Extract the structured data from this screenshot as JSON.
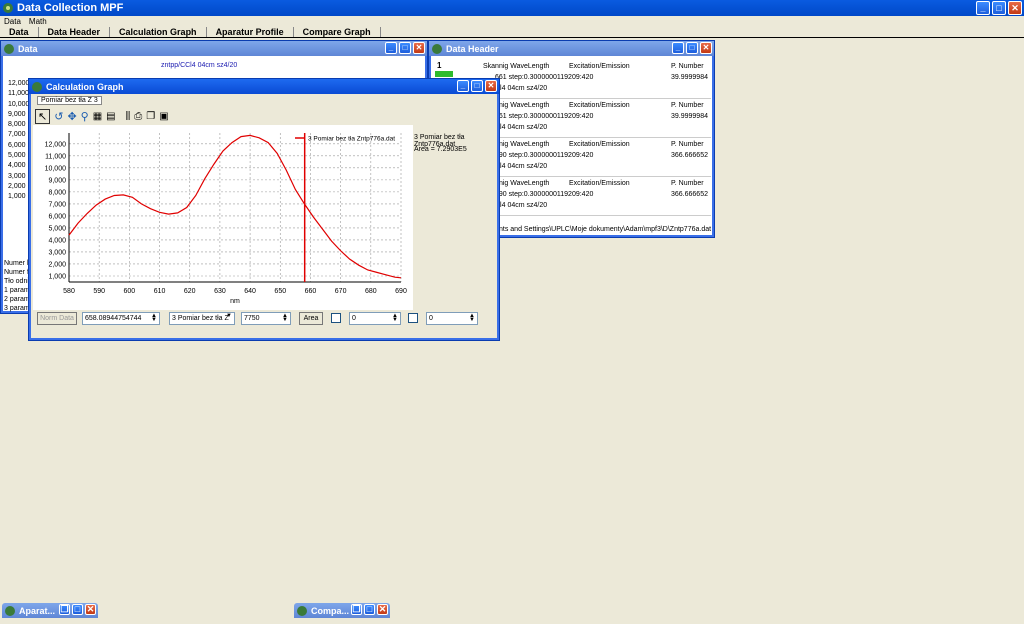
{
  "app": {
    "title": "Data Collection MPF"
  },
  "menu": [
    "Data",
    "Math"
  ],
  "tabs": [
    "Data",
    "Data Header",
    "Calculation Graph",
    "Aparatur Profile",
    "Compare Graph"
  ],
  "data_window": {
    "title": "Data",
    "subtitle": "zntpp/CCl4 04cm sz4/20",
    "y_values": [
      "12,000",
      "11,000",
      "10,000",
      "9,000",
      "8,000",
      "7,000",
      "6,000",
      "5,000",
      "4,000",
      "3,000",
      "2,000",
      "1,000"
    ],
    "info_lines": [
      "Numer k",
      "Numer fil",
      "Tło odni",
      "1 param",
      "2 param",
      "3 param"
    ]
  },
  "header_window": {
    "title": "Data Header",
    "index": "1",
    "entries": [
      {
        "col1": "Skannig WaveLength",
        "col2": "Excitation/Emission",
        "col3": "P. Number",
        "line2": "661 step:0.3000000119209:420",
        "val": "39.9999984",
        "line3": "Cl4 04cm sz4/20"
      },
      {
        "col1": "Skannig WaveLength",
        "col2": "Excitation/Emission",
        "col3": "P. Number",
        "line2": "661 step:0.3000000119209:420",
        "val": "39.9999984",
        "line3": "Cl4 04cm sz4/20"
      },
      {
        "col1": "Skannig WaveLength",
        "col2": "Excitation/Emission",
        "col3": "P. Number",
        "line2": "690 step:0.3000000119209:420",
        "val": "366.666652",
        "line3": "Cl4 04cm sz4/20"
      },
      {
        "col1": "Skannig WaveLength",
        "col2": "Excitation/Emission",
        "col3": "P. Number",
        "line2": "690 step:0.3000000119209:420",
        "val": "366.666652",
        "line3": "Cl4 04cm sz4/20"
      }
    ],
    "path": "nts and Settings\\UPLC\\Moje dokumenty\\Adam\\mpf3\\D\\Zntp776a.dat"
  },
  "calc_window": {
    "title": "Calculation Graph",
    "subtab": "Pomiar bez tła Z 3",
    "legend_label": "3 Pomiar bez tła Zntp776a.dat",
    "side_label": "3 Pomiar bez tła Zntp776a.dat",
    "area_text": "Area = 7.2903E5",
    "norm_button": "Norm Data",
    "value_field": "658.08944754744",
    "series_select": "3 Pomiar bez tła Z",
    "level_field": "7750",
    "area_button": "Area",
    "field_a": "0",
    "field_b": "0"
  },
  "minimized": [
    "Aparat...",
    "Compa..."
  ],
  "colors": {
    "series": "#E00000",
    "cursor": "#E00000",
    "titlebar": "#0A5BE0"
  },
  "chart_data": {
    "type": "line",
    "xlabel": "nm",
    "xlim": [
      580,
      690
    ],
    "ylim": [
      500,
      12900
    ],
    "x_ticks": [
      580,
      590,
      600,
      610,
      620,
      630,
      640,
      650,
      660,
      670,
      680,
      690
    ],
    "y_ticks": [
      1000,
      2000,
      3000,
      4000,
      5000,
      6000,
      7000,
      8000,
      9000,
      10000,
      11000,
      12000
    ],
    "grid": true,
    "legend": "top-right",
    "series": [
      {
        "name": "3 Pomiar bez tła Zntp776a.dat",
        "x": [
          580,
          583,
          586,
          589,
          592,
          595,
          598,
          601,
          604,
          607,
          610,
          613,
          616,
          619,
          622,
          625,
          628,
          631,
          634,
          637,
          640,
          643,
          646,
          649,
          652,
          655,
          658,
          661,
          664,
          667,
          670,
          673,
          676,
          679,
          682,
          685,
          688,
          690
        ],
        "y": [
          4400,
          5400,
          6200,
          6900,
          7400,
          7700,
          7750,
          7550,
          7000,
          6600,
          6300,
          6150,
          6250,
          6700,
          7700,
          9100,
          10300,
          11400,
          12100,
          12600,
          12700,
          12500,
          12100,
          11200,
          9800,
          8200,
          7000,
          5900,
          4900,
          3900,
          3100,
          2400,
          1900,
          1500,
          1300,
          1100,
          900,
          850
        ]
      }
    ],
    "cursor_x": 658.08944754744
  }
}
